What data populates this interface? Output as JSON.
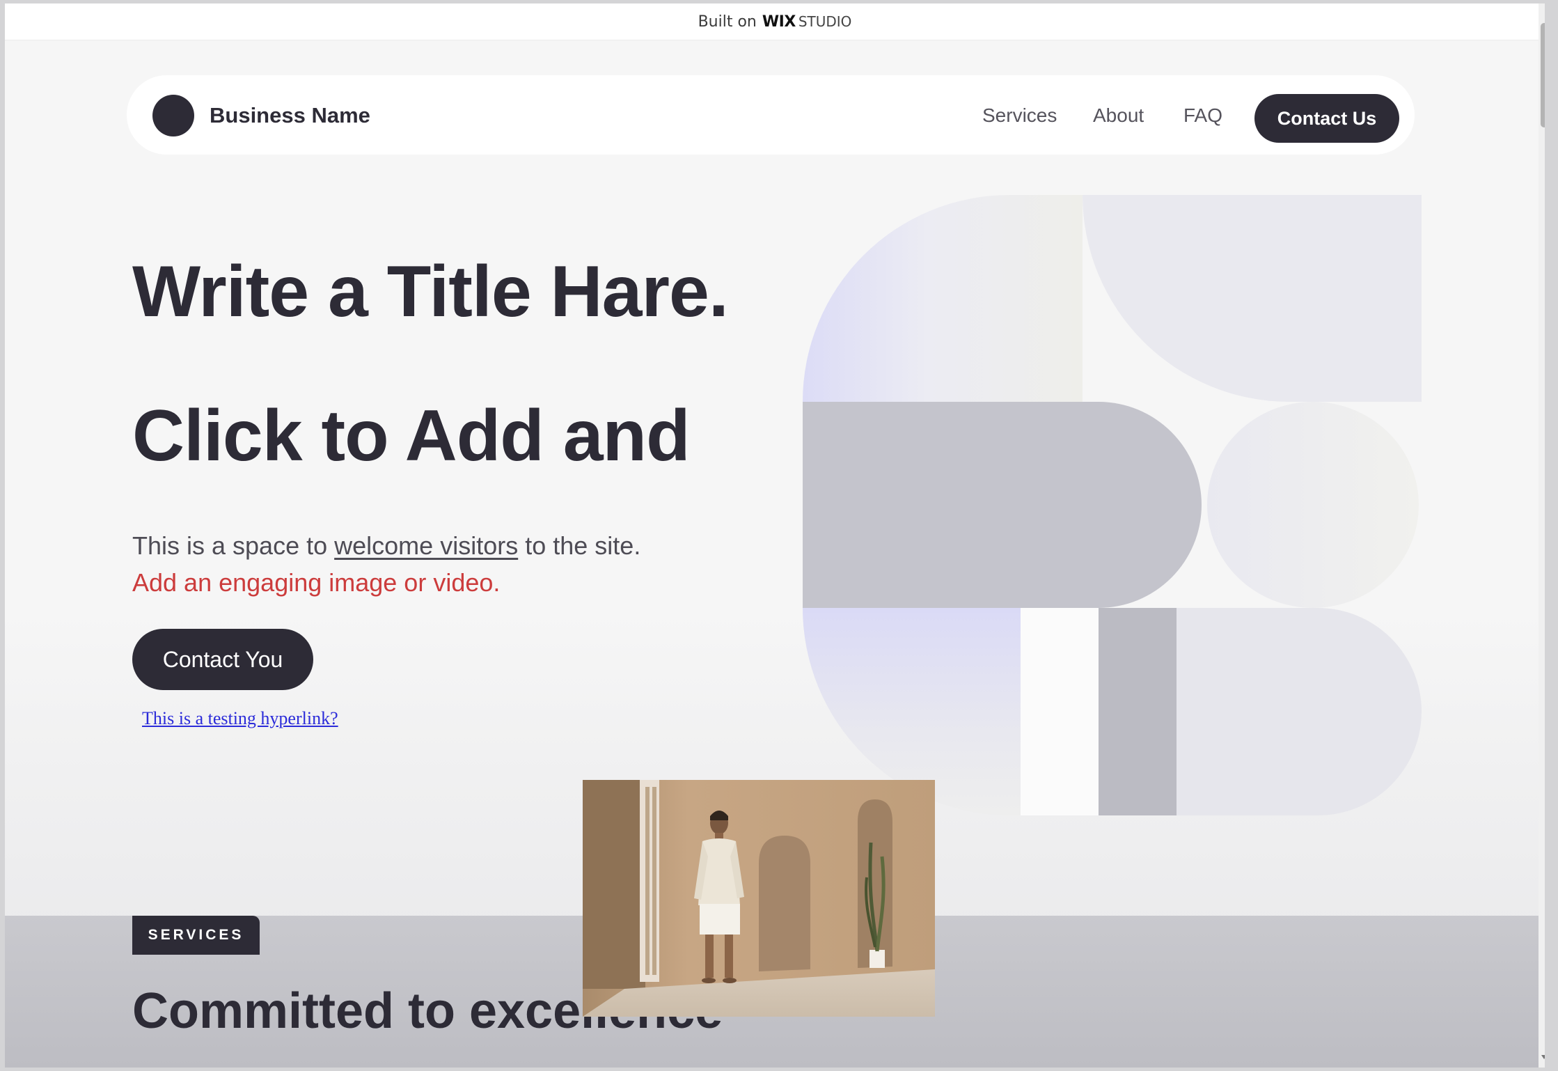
{
  "wix_banner": {
    "prefix": "Built on",
    "brand": "WIX",
    "product": "STUDIO"
  },
  "header": {
    "brand_name": "Business Name",
    "nav": [
      {
        "label": "Services"
      },
      {
        "label": "About"
      },
      {
        "label": "FAQ"
      }
    ],
    "cta_label": "Contact Us"
  },
  "hero": {
    "title_line1": "Write a Title Hare.",
    "title_line2": "Click to Add and",
    "body_start": "This is a space to",
    "body_link": "welcome visitors",
    "body_mid": "to the site.",
    "body_highlight": "Add an engaging image or video.",
    "cta_label": "Contact You",
    "test_link": "This is a testing hyperlink?"
  },
  "services": {
    "tag": "SERVICES",
    "heading": "Committed to excellence"
  },
  "colors": {
    "primary_dark": "#2d2b36",
    "highlight_red": "#cc3c3c",
    "hyperlink_blue": "#2b2bd9"
  }
}
